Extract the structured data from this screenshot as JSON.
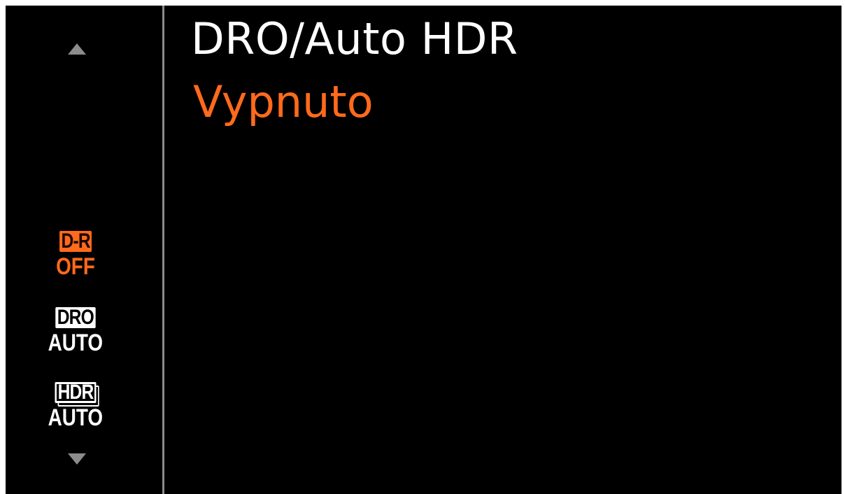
{
  "menu": {
    "title": "DRO/Auto HDR",
    "selected_value": "Vypnuto"
  },
  "options": [
    {
      "badge": "D-R",
      "label": "OFF",
      "selected": true
    },
    {
      "badge": "DRO",
      "label": "AUTO",
      "selected": false
    },
    {
      "badge": "HDR",
      "label": "AUTO",
      "selected": false
    }
  ],
  "colors": {
    "accent": "#ff6a1c",
    "background": "#000000",
    "text": "#ffffff",
    "divider": "#8a8a8a",
    "arrow": "#8c8c8c"
  },
  "icons": {
    "scroll_up": "triangle-up",
    "scroll_down": "triangle-down"
  }
}
